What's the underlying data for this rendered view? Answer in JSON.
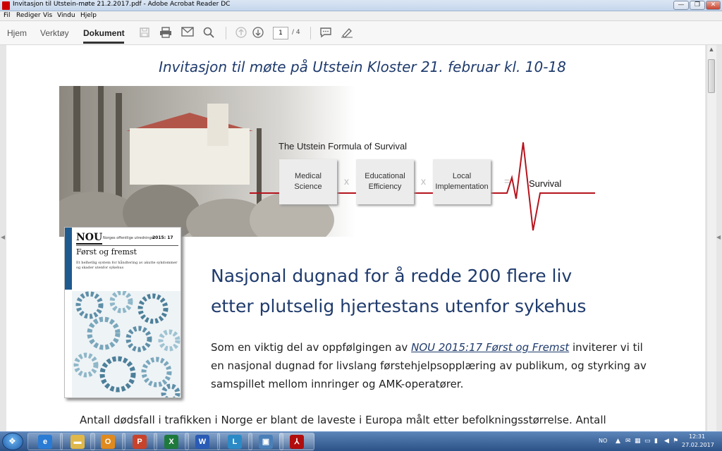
{
  "window": {
    "title": "Invitasjon til Utstein-møte 21.2.2017.pdf - Adobe Acrobat Reader DC",
    "minimize": "—",
    "maximize": "❐",
    "close": "✕"
  },
  "menu": [
    "Fil",
    "Rediger",
    "Vis",
    "Vindu",
    "Hjelp"
  ],
  "toolbar": {
    "tabs": [
      "Hjem",
      "Verktøy",
      "Dokument"
    ],
    "active_tab": "Dokument",
    "page_current": "1",
    "page_total": "/ 4",
    "icons": [
      "save-icon",
      "print-icon",
      "email-icon",
      "search-icon",
      "page-up-icon",
      "page-down-icon",
      "comment-icon",
      "pen-icon"
    ]
  },
  "document": {
    "title": "Invitasjon til møte på Utstein Kloster 21. februar kl. 10-18",
    "formula": {
      "title": "The Utstein Formula of Survival",
      "box1": [
        "Medical",
        "Science"
      ],
      "box2": [
        "Educational",
        "Efficiency"
      ],
      "box3": [
        "Local",
        "Implementation"
      ],
      "op_times": "x",
      "op_equals": "=",
      "result": "Survival"
    },
    "cover": {
      "nou": "NOU",
      "series": "Norges offentlige utredninger",
      "number": "2015: 17",
      "title": "Først og fremst",
      "subtitle": "Et helhetlig system for håndtering av akutte sykdommer og skader utenfor sykehus"
    },
    "heading_line1": "Nasjonal dugnad for å redde 200 flere liv",
    "heading_line2": "etter plutselig hjertestans utenfor sykehus",
    "para_l1_a": "Som en viktig del av oppfølgingen av",
    "para_l1_link": "NOU 2015:17 Først og Fremst",
    "para_l1_b": "inviterer vi til",
    "para_l2": "en nasjonal dugnad for livslang førstehjelpsopplæring av publikum, og styrking av",
    "para_l3": "samspillet mellom innringer og AMK-operatører.",
    "para_l4": "Antall dødsfall i trafikken i Norge er blant de laveste i Europa målt etter befolkningsstørrelse. Antall"
  },
  "taskbar": {
    "start_glyph": "❖",
    "apps": [
      {
        "name": "ie",
        "glyph": "e",
        "color": "#2a7bd4"
      },
      {
        "name": "explorer",
        "glyph": "▬",
        "color": "#e0b84a"
      },
      {
        "name": "outlook",
        "glyph": "O",
        "color": "#e08a1e"
      },
      {
        "name": "powerpoint",
        "glyph": "P",
        "color": "#c8432b"
      },
      {
        "name": "excel",
        "glyph": "X",
        "color": "#1e7a3c"
      },
      {
        "name": "word",
        "glyph": "W",
        "color": "#2a5bb5"
      },
      {
        "name": "lync",
        "glyph": "L",
        "color": "#2b8ac6"
      },
      {
        "name": "remote",
        "glyph": "▣",
        "color": "#4a7fb8"
      },
      {
        "name": "acrobat",
        "glyph": "⅄",
        "color": "#b10d0d"
      }
    ],
    "language": "NO",
    "time": "12:31",
    "date": "27.02.2017"
  }
}
